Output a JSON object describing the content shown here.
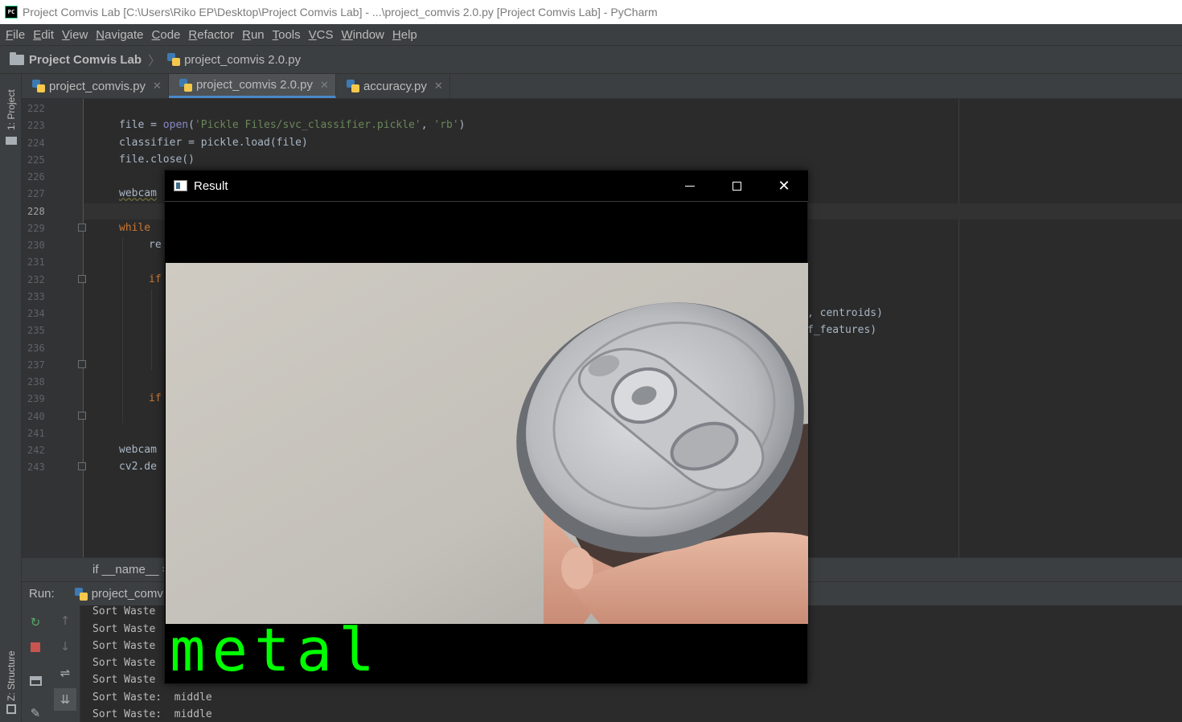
{
  "window": {
    "title": "Project Comvis Lab [C:\\Users\\Riko EP\\Desktop\\Project Comvis Lab] - ...\\project_comvis 2.0.py [Project Comvis Lab] - PyCharm",
    "app_icon": "PC"
  },
  "menu": [
    "File",
    "Edit",
    "View",
    "Navigate",
    "Code",
    "Refactor",
    "Run",
    "Tools",
    "VCS",
    "Window",
    "Help"
  ],
  "navbar": {
    "project": "Project Comvis Lab",
    "file": "project_comvis 2.0.py"
  },
  "left_stripe": {
    "project": "1: Project",
    "structure": "Z: Structure"
  },
  "tabs": [
    {
      "label": "project_comvis.py",
      "active": false
    },
    {
      "label": "project_comvis 2.0.py",
      "active": true
    },
    {
      "label": "accuracy.py",
      "active": false
    }
  ],
  "editor": {
    "line_numbers": [
      "222",
      "223",
      "224",
      "225",
      "226",
      "227",
      "228",
      "229",
      "230",
      "231",
      "232",
      "233",
      "234",
      "235",
      "236",
      "237",
      "238",
      "239",
      "240",
      "241",
      "242",
      "243"
    ],
    "current_line": "228",
    "code": {
      "l223_a": "file = ",
      "l223_fn": "open",
      "l223_b": "(",
      "l223_s1": "'Pickle Files/svc_classifier.pickle'",
      "l223_c": ", ",
      "l223_s2": "'rb'",
      "l223_d": ")",
      "l224": "classifier = pickle.load(file)",
      "l225": "file.close()",
      "l227": "webcam",
      "l229": "while",
      "l230": "re",
      "l232": "if",
      "l234": ", centroids)",
      "l235": "f_features)",
      "l239": "if",
      "l242": "webcam",
      "l243": "cv2.de"
    },
    "bottom_breadcrumb": "if __name__ =="
  },
  "run_panel": {
    "label": "Run:",
    "tab": "project_comv",
    "output": [
      "Sort Waste",
      "Sort Waste",
      "Sort Waste",
      "Sort Waste",
      "Sort Waste",
      "Sort Waste:  middle",
      "Sort Waste:  middle"
    ]
  },
  "result_window": {
    "title": "Result",
    "prediction": "metal"
  },
  "colors": {
    "prediction_text": "#00ff00",
    "active_tab_underline": "#4a88c7",
    "keyword": "#cc7832",
    "string": "#6a8759"
  }
}
